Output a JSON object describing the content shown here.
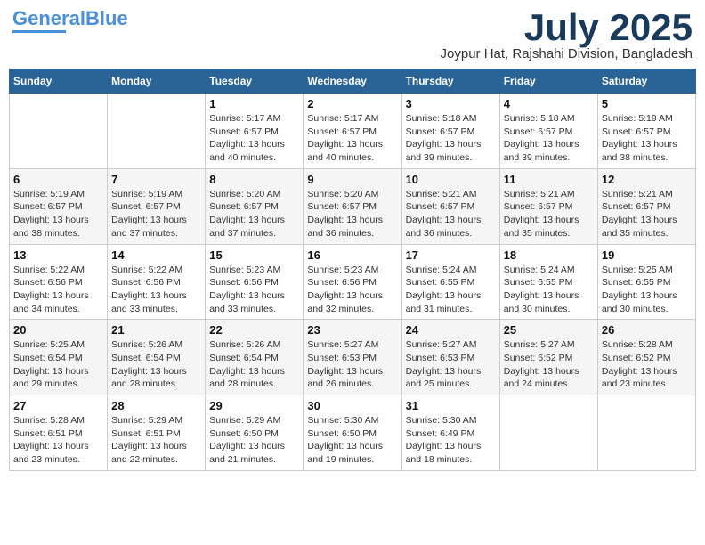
{
  "header": {
    "logo_line1": "General",
    "logo_line2": "Blue",
    "month_title": "July 2025",
    "location": "Joypur Hat, Rajshahi Division, Bangladesh"
  },
  "weekdays": [
    "Sunday",
    "Monday",
    "Tuesday",
    "Wednesday",
    "Thursday",
    "Friday",
    "Saturday"
  ],
  "weeks": [
    [
      {
        "day": "",
        "info": ""
      },
      {
        "day": "",
        "info": ""
      },
      {
        "day": "1",
        "info": "Sunrise: 5:17 AM\nSunset: 6:57 PM\nDaylight: 13 hours and 40 minutes."
      },
      {
        "day": "2",
        "info": "Sunrise: 5:17 AM\nSunset: 6:57 PM\nDaylight: 13 hours and 40 minutes."
      },
      {
        "day": "3",
        "info": "Sunrise: 5:18 AM\nSunset: 6:57 PM\nDaylight: 13 hours and 39 minutes."
      },
      {
        "day": "4",
        "info": "Sunrise: 5:18 AM\nSunset: 6:57 PM\nDaylight: 13 hours and 39 minutes."
      },
      {
        "day": "5",
        "info": "Sunrise: 5:19 AM\nSunset: 6:57 PM\nDaylight: 13 hours and 38 minutes."
      }
    ],
    [
      {
        "day": "6",
        "info": "Sunrise: 5:19 AM\nSunset: 6:57 PM\nDaylight: 13 hours and 38 minutes."
      },
      {
        "day": "7",
        "info": "Sunrise: 5:19 AM\nSunset: 6:57 PM\nDaylight: 13 hours and 37 minutes."
      },
      {
        "day": "8",
        "info": "Sunrise: 5:20 AM\nSunset: 6:57 PM\nDaylight: 13 hours and 37 minutes."
      },
      {
        "day": "9",
        "info": "Sunrise: 5:20 AM\nSunset: 6:57 PM\nDaylight: 13 hours and 36 minutes."
      },
      {
        "day": "10",
        "info": "Sunrise: 5:21 AM\nSunset: 6:57 PM\nDaylight: 13 hours and 36 minutes."
      },
      {
        "day": "11",
        "info": "Sunrise: 5:21 AM\nSunset: 6:57 PM\nDaylight: 13 hours and 35 minutes."
      },
      {
        "day": "12",
        "info": "Sunrise: 5:21 AM\nSunset: 6:57 PM\nDaylight: 13 hours and 35 minutes."
      }
    ],
    [
      {
        "day": "13",
        "info": "Sunrise: 5:22 AM\nSunset: 6:56 PM\nDaylight: 13 hours and 34 minutes."
      },
      {
        "day": "14",
        "info": "Sunrise: 5:22 AM\nSunset: 6:56 PM\nDaylight: 13 hours and 33 minutes."
      },
      {
        "day": "15",
        "info": "Sunrise: 5:23 AM\nSunset: 6:56 PM\nDaylight: 13 hours and 33 minutes."
      },
      {
        "day": "16",
        "info": "Sunrise: 5:23 AM\nSunset: 6:56 PM\nDaylight: 13 hours and 32 minutes."
      },
      {
        "day": "17",
        "info": "Sunrise: 5:24 AM\nSunset: 6:55 PM\nDaylight: 13 hours and 31 minutes."
      },
      {
        "day": "18",
        "info": "Sunrise: 5:24 AM\nSunset: 6:55 PM\nDaylight: 13 hours and 30 minutes."
      },
      {
        "day": "19",
        "info": "Sunrise: 5:25 AM\nSunset: 6:55 PM\nDaylight: 13 hours and 30 minutes."
      }
    ],
    [
      {
        "day": "20",
        "info": "Sunrise: 5:25 AM\nSunset: 6:54 PM\nDaylight: 13 hours and 29 minutes."
      },
      {
        "day": "21",
        "info": "Sunrise: 5:26 AM\nSunset: 6:54 PM\nDaylight: 13 hours and 28 minutes."
      },
      {
        "day": "22",
        "info": "Sunrise: 5:26 AM\nSunset: 6:54 PM\nDaylight: 13 hours and 28 minutes."
      },
      {
        "day": "23",
        "info": "Sunrise: 5:27 AM\nSunset: 6:53 PM\nDaylight: 13 hours and 26 minutes."
      },
      {
        "day": "24",
        "info": "Sunrise: 5:27 AM\nSunset: 6:53 PM\nDaylight: 13 hours and 25 minutes."
      },
      {
        "day": "25",
        "info": "Sunrise: 5:27 AM\nSunset: 6:52 PM\nDaylight: 13 hours and 24 minutes."
      },
      {
        "day": "26",
        "info": "Sunrise: 5:28 AM\nSunset: 6:52 PM\nDaylight: 13 hours and 23 minutes."
      }
    ],
    [
      {
        "day": "27",
        "info": "Sunrise: 5:28 AM\nSunset: 6:51 PM\nDaylight: 13 hours and 23 minutes."
      },
      {
        "day": "28",
        "info": "Sunrise: 5:29 AM\nSunset: 6:51 PM\nDaylight: 13 hours and 22 minutes."
      },
      {
        "day": "29",
        "info": "Sunrise: 5:29 AM\nSunset: 6:50 PM\nDaylight: 13 hours and 21 minutes."
      },
      {
        "day": "30",
        "info": "Sunrise: 5:30 AM\nSunset: 6:50 PM\nDaylight: 13 hours and 19 minutes."
      },
      {
        "day": "31",
        "info": "Sunrise: 5:30 AM\nSunset: 6:49 PM\nDaylight: 13 hours and 18 minutes."
      },
      {
        "day": "",
        "info": ""
      },
      {
        "day": "",
        "info": ""
      }
    ]
  ]
}
